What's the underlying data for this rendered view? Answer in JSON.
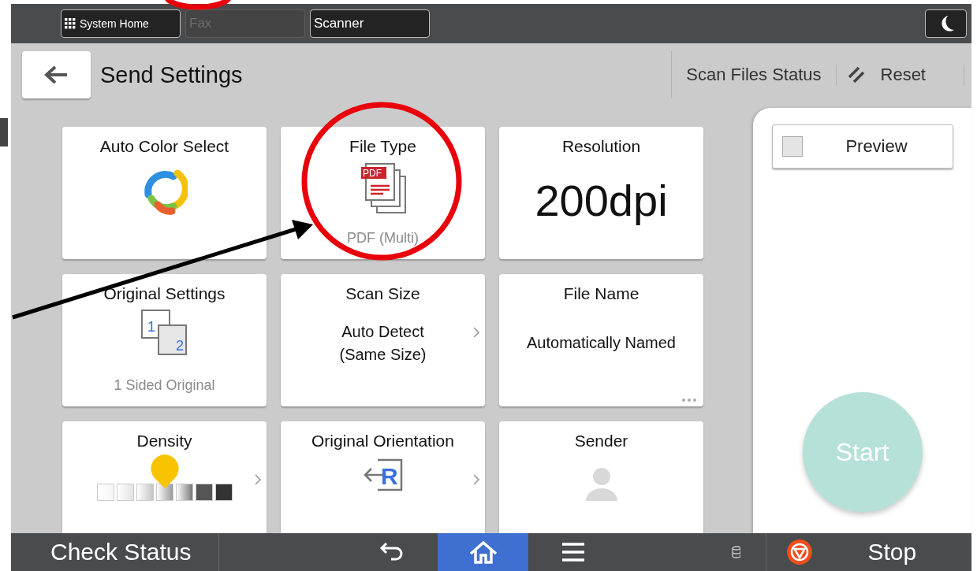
{
  "top_bar": {
    "tabs": [
      {
        "label": "System Home",
        "kind": "home",
        "disabled": false
      },
      {
        "label": "Fax",
        "kind": "plain",
        "disabled": true
      },
      {
        "label": "Scanner",
        "kind": "plain",
        "disabled": false
      }
    ]
  },
  "header": {
    "title": "Send Settings",
    "actions": [
      {
        "label": "Scan Files Status",
        "kind": "text"
      },
      {
        "label": "Reset",
        "kind": "reset"
      }
    ]
  },
  "tiles": [
    {
      "title": "Auto Color Select",
      "kind": "color",
      "chevron": false,
      "more": false
    },
    {
      "title": "File Type",
      "kind": "pdf",
      "icon_label": "PDF",
      "caption": "PDF (Multi)",
      "chevron": false,
      "more": false
    },
    {
      "title": "Resolution",
      "kind": "value",
      "value": "200dpi",
      "chevron": false,
      "more": false
    },
    {
      "title": "Original Settings",
      "kind": "sides",
      "icon_labels": [
        "1",
        "2"
      ],
      "caption": "1 Sided Original",
      "chevron": false,
      "more": false
    },
    {
      "title": "Scan Size",
      "kind": "text",
      "value": "Auto Detect\n(Same Size)",
      "chevron": true,
      "more": false
    },
    {
      "title": "File Name",
      "kind": "text",
      "value": "Automatically Named",
      "chevron": false,
      "more": true
    },
    {
      "title": "Density",
      "kind": "density",
      "level": 0.5,
      "chevron": true,
      "more": false
    },
    {
      "title": "Original Orientation",
      "kind": "orientation",
      "icon_label": "R",
      "chevron": true,
      "more": false
    },
    {
      "title": "Sender",
      "kind": "sender",
      "chevron": false,
      "more": false
    }
  ],
  "side_panel": {
    "preview": {
      "label": "Preview",
      "checked": false
    },
    "start": {
      "label": "Start",
      "disabled": true
    }
  },
  "bottom_bar": {
    "check_status": "Check Status",
    "nav": [
      {
        "kind": "back",
        "selected": false
      },
      {
        "kind": "home",
        "selected": true
      },
      {
        "kind": "menu",
        "selected": false
      }
    ],
    "stop": "Stop"
  }
}
